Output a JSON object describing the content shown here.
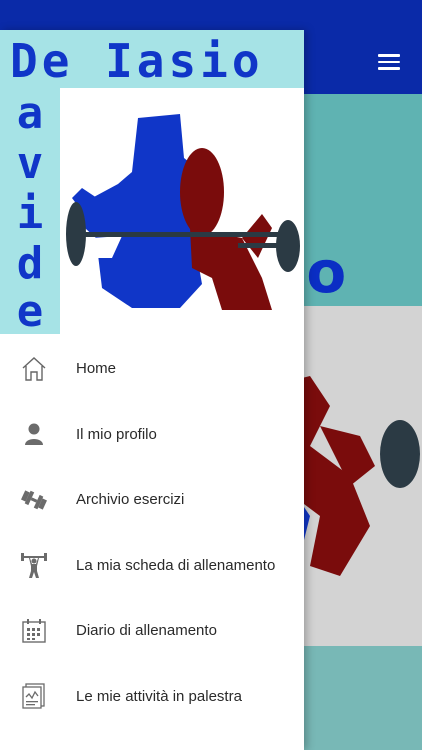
{
  "colors": {
    "header": "#0a2aa8",
    "logo_blue": "#1036c8",
    "logo_bg": "#a6e3e6",
    "figure_red": "#7a0c0c",
    "barbell": "#2b3a44"
  },
  "logo": {
    "top_text": "De Iasio",
    "side_letters": [
      "a",
      "v",
      "i",
      "d",
      "e"
    ]
  },
  "background": {
    "partial_logo_text": "sio"
  },
  "menu": {
    "items": [
      {
        "label": "Home",
        "icon": "home-icon"
      },
      {
        "label": "Il mio profilo",
        "icon": "user-icon"
      },
      {
        "label": "Archivio esercizi",
        "icon": "dumbbell-icon"
      },
      {
        "label": "La mia scheda di allenamento",
        "icon": "weightlifter-icon"
      },
      {
        "label": "Diario di allenamento",
        "icon": "calendar-icon"
      },
      {
        "label": "Le mie attività in palestra",
        "icon": "report-icon"
      }
    ]
  }
}
